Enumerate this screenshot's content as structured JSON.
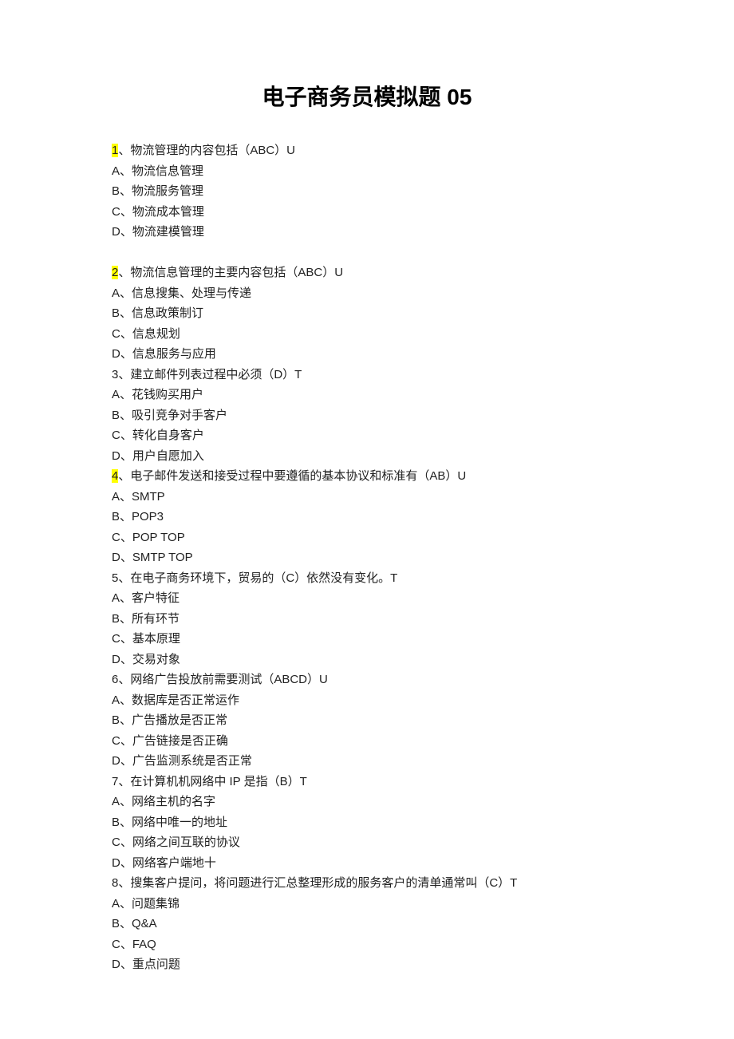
{
  "title": "电子商务员模拟题 05",
  "lines": [
    {
      "num": "1",
      "hl": true,
      "rest": "、物流管理的内容包括（ABC）U"
    },
    {
      "num": "",
      "hl": false,
      "rest": "A、物流信息管理"
    },
    {
      "num": "",
      "hl": false,
      "rest": "B、物流服务管理"
    },
    {
      "num": "",
      "hl": false,
      "rest": "C、物流成本管理"
    },
    {
      "num": "",
      "hl": false,
      "rest": "D、物流建模管理"
    },
    {
      "num": "",
      "hl": false,
      "rest": ""
    },
    {
      "num": "2",
      "hl": true,
      "rest": "、物流信息管理的主要内容包括（ABC）U"
    },
    {
      "num": "",
      "hl": false,
      "rest": "A、信息搜集、处理与传递"
    },
    {
      "num": "",
      "hl": false,
      "rest": "B、信息政策制订"
    },
    {
      "num": "",
      "hl": false,
      "rest": "C、信息规划"
    },
    {
      "num": "",
      "hl": false,
      "rest": "D、信息服务与应用"
    },
    {
      "num": "",
      "hl": false,
      "rest": "3、建立邮件列表过程中必须（D）T"
    },
    {
      "num": "",
      "hl": false,
      "rest": "A、花钱购买用户"
    },
    {
      "num": "",
      "hl": false,
      "rest": "B、吸引竞争对手客户"
    },
    {
      "num": "",
      "hl": false,
      "rest": "C、转化自身客户"
    },
    {
      "num": "",
      "hl": false,
      "rest": "D、用户自愿加入"
    },
    {
      "num": "4",
      "hl": true,
      "rest": "、电子邮件发送和接受过程中要遵循的基本协议和标准有（AB）U"
    },
    {
      "num": "",
      "hl": false,
      "rest": "A、SMTP"
    },
    {
      "num": "",
      "hl": false,
      "rest": "B、POP3"
    },
    {
      "num": "",
      "hl": false,
      "rest": "C、POP TOP"
    },
    {
      "num": "",
      "hl": false,
      "rest": "D、SMTP TOP"
    },
    {
      "num": "",
      "hl": false,
      "rest": "5、在电子商务环境下，贸易的（C）依然没有变化。T"
    },
    {
      "num": "",
      "hl": false,
      "rest": "A、客户特征"
    },
    {
      "num": "",
      "hl": false,
      "rest": "B、所有环节"
    },
    {
      "num": "",
      "hl": false,
      "rest": "C、基本原理"
    },
    {
      "num": "",
      "hl": false,
      "rest": "D、交易对象"
    },
    {
      "num": "",
      "hl": false,
      "rest": "6、网络广告投放前需要测试（ABCD）U"
    },
    {
      "num": "",
      "hl": false,
      "rest": "A、数据库是否正常运作"
    },
    {
      "num": "",
      "hl": false,
      "rest": "B、广告播放是否正常"
    },
    {
      "num": "",
      "hl": false,
      "rest": "C、广告链接是否正确"
    },
    {
      "num": "",
      "hl": false,
      "rest": "D、广告监测系统是否正常"
    },
    {
      "num": "",
      "hl": false,
      "rest": "7、在计算机机网络中 IP 是指（B）T"
    },
    {
      "num": "",
      "hl": false,
      "rest": "A、网络主机的名字"
    },
    {
      "num": "",
      "hl": false,
      "rest": "B、网络中唯一的地址"
    },
    {
      "num": "",
      "hl": false,
      "rest": "C、网络之间互联的协议"
    },
    {
      "num": "",
      "hl": false,
      "rest": "D、网络客户端地十"
    },
    {
      "num": "",
      "hl": false,
      "rest": "8、搜集客户提问，将问题进行汇总整理形成的服务客户的清单通常叫（C）T"
    },
    {
      "num": "",
      "hl": false,
      "rest": "A、问题集锦"
    },
    {
      "num": "",
      "hl": false,
      "rest": "B、Q&A"
    },
    {
      "num": "",
      "hl": false,
      "rest": "C、FAQ"
    },
    {
      "num": "",
      "hl": false,
      "rest": "D、重点问题"
    }
  ]
}
